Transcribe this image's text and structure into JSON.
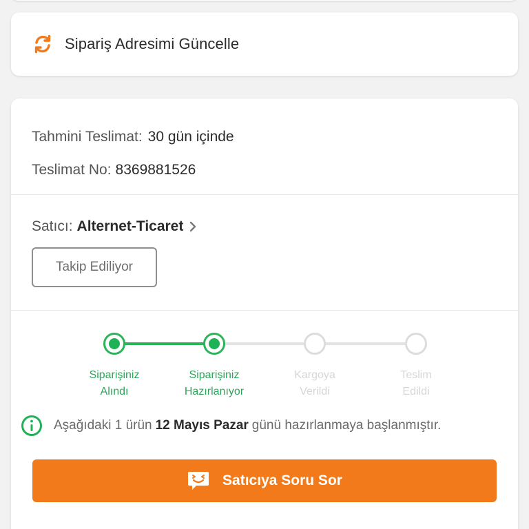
{
  "address_card": {
    "title": "Sipariş Adresimi Güncelle",
    "icon": "refresh-icon",
    "icon_color": "#f27a1a"
  },
  "delivery": {
    "estimated_label": "Tahmini Teslimat:",
    "estimated_value": "30 gün içinde",
    "number_label": "Teslimat No:",
    "number_value": "8369881526"
  },
  "seller": {
    "label": "Satıcı:",
    "name": "Alternet-Ticaret",
    "follow_button": "Takip Ediliyor"
  },
  "tracker": {
    "steps": [
      {
        "line1": "Siparişiniz",
        "line2": "Alındı",
        "status": "done"
      },
      {
        "line1": "Siparişiniz",
        "line2": "Hazırlanıyor",
        "status": "current"
      },
      {
        "line1": "Kargoya",
        "line2": "Verildi",
        "status": "pending"
      },
      {
        "line1": "Teslim",
        "line2": "Edildi",
        "status": "pending"
      }
    ],
    "active_color": "#1fb155",
    "inactive_color": "#dcdcdc"
  },
  "info": {
    "prefix": "Aşağıdaki 1 ürün",
    "date": "12 Mayıs Pazar",
    "suffix": "günü hazırlanmaya başlanmıştır."
  },
  "ask_button": {
    "label": "Satıcıya Soru Sor",
    "icon": "chat-smile-icon",
    "color": "#f27a1a"
  }
}
